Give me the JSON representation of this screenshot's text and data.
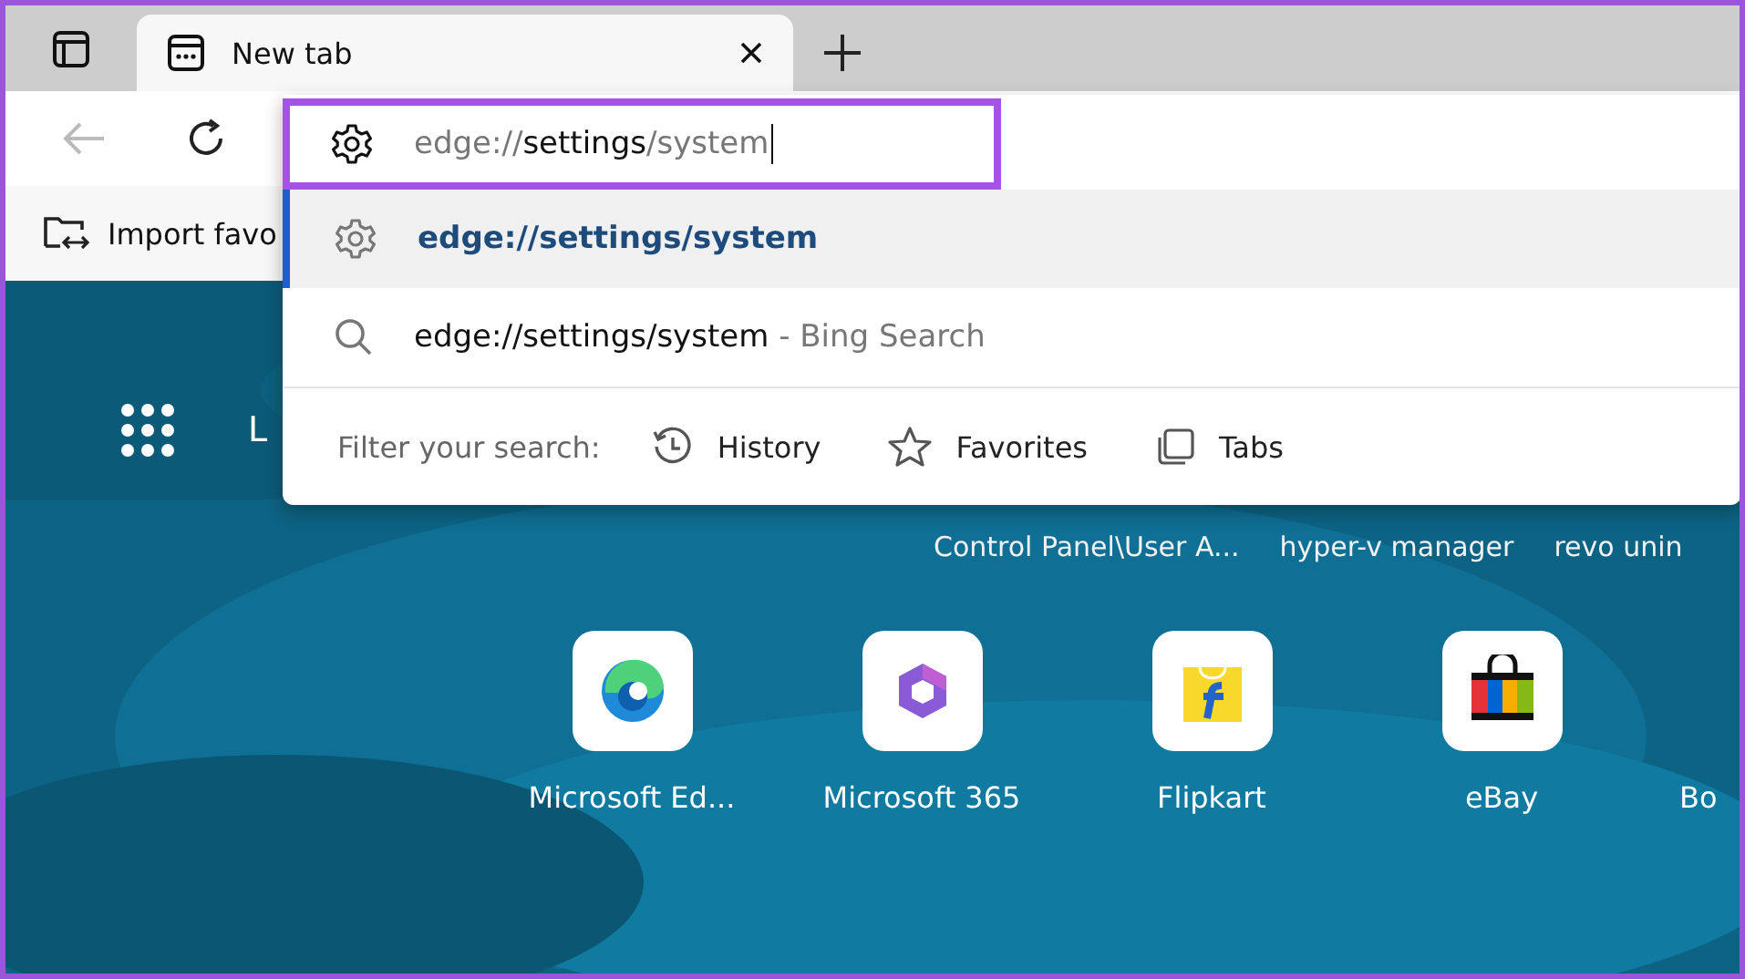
{
  "tabs": [
    {
      "label": "New tab",
      "selected": true
    }
  ],
  "address": {
    "parts": [
      {
        "text": "edge://",
        "kind": "dim"
      },
      {
        "text": "settings",
        "kind": "strong"
      },
      {
        "text": "/system",
        "kind": "dim"
      }
    ]
  },
  "favorites_bar": {
    "import_label": "Import favo"
  },
  "suggestions": [
    {
      "kind": "settings",
      "text": "edge://settings/system",
      "selected": true
    },
    {
      "kind": "search",
      "text": "edge://settings/system",
      "suffix": " - Bing Search",
      "selected": false
    }
  ],
  "filter": {
    "label": "Filter your search:",
    "options": [
      {
        "kind": "history",
        "label": "History"
      },
      {
        "kind": "favorites",
        "label": "Favorites"
      },
      {
        "kind": "tabs",
        "label": "Tabs"
      }
    ]
  },
  "greeting": "L",
  "top_sites": [
    "Control Panel\\User A...",
    "hyper-v manager",
    "revo unin"
  ],
  "quick_links": [
    {
      "kind": "edge",
      "label": "Microsoft Ed..."
    },
    {
      "kind": "m365",
      "label": "Microsoft 365"
    },
    {
      "kind": "flipkart",
      "label": "Flipkart"
    },
    {
      "kind": "ebay",
      "label": "eBay"
    },
    {
      "kind": "none",
      "label": "Bo"
    }
  ]
}
